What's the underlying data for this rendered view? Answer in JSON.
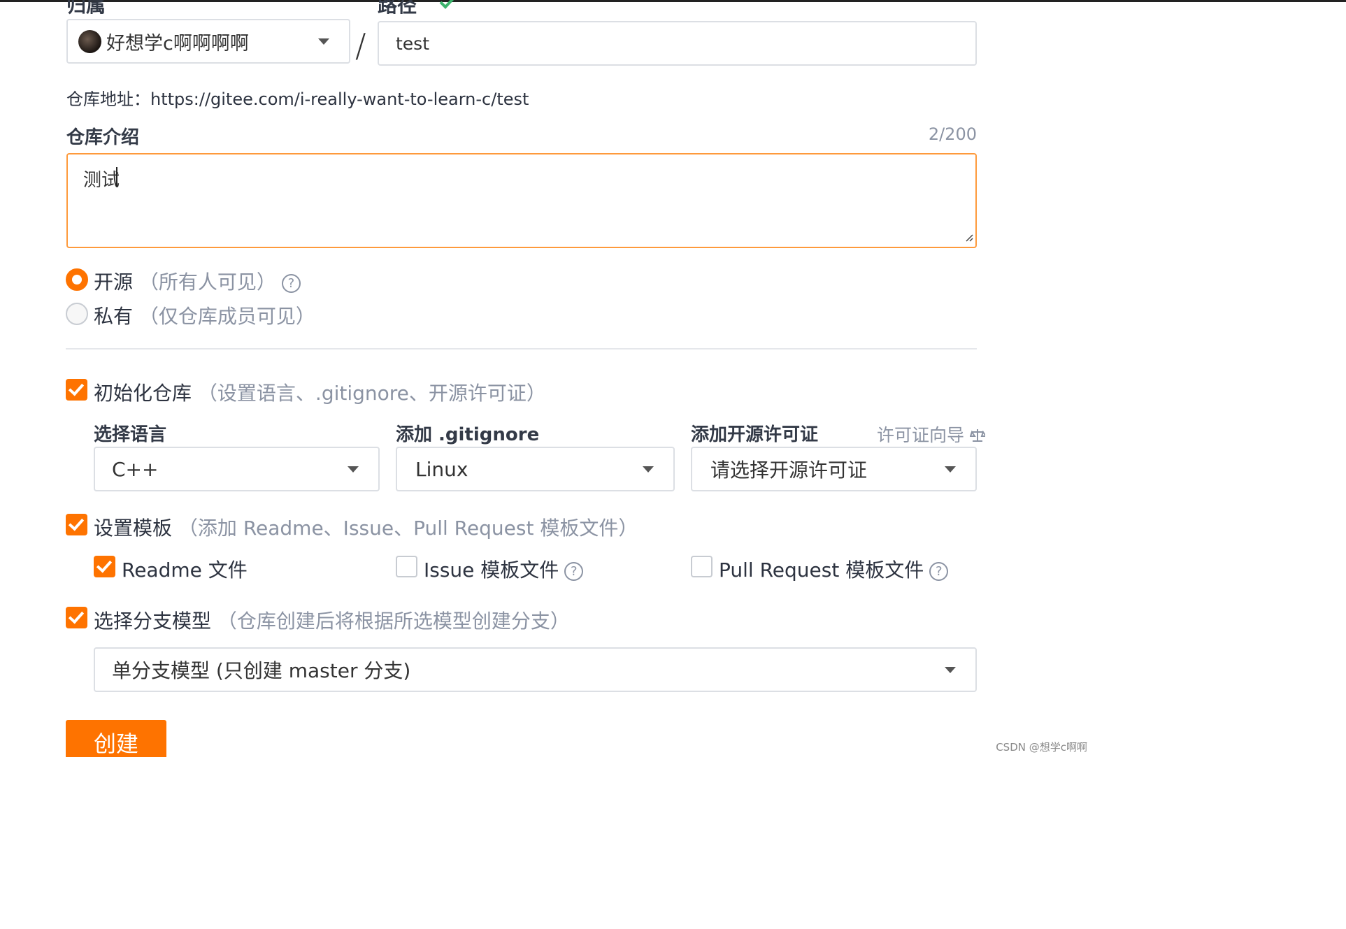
{
  "owner": {
    "label": "归属",
    "value": "好想学c啊啊啊啊"
  },
  "path": {
    "label": "路径",
    "required_mark": "*",
    "value": "test"
  },
  "separator": "/",
  "repo_address": {
    "label": "仓库地址：",
    "url": "https://gitee.com/i-really-want-to-learn-c/test"
  },
  "description": {
    "label": "仓库介绍",
    "counter": "2/200",
    "value": "测试"
  },
  "visibility": [
    {
      "label": "开源",
      "hint": "（所有人可见）",
      "selected": true
    },
    {
      "label": "私有",
      "hint": "（仅仓库成员可见）",
      "selected": false
    }
  ],
  "init_repo": {
    "label": "初始化仓库",
    "hint": "（设置语言、.gitignore、开源许可证）",
    "checked": true
  },
  "language": {
    "label": "选择语言",
    "value": "C++"
  },
  "gitignore": {
    "label": "添加 .gitignore",
    "value": "Linux"
  },
  "license": {
    "label": "添加开源许可证",
    "wizard_link": "许可证向导",
    "value": "请选择开源许可证"
  },
  "templates": {
    "label": "设置模板",
    "hint": "（添加 Readme、Issue、Pull Request 模板文件）",
    "checked": true,
    "readme": {
      "label": "Readme 文件",
      "checked": true
    },
    "issue": {
      "label": "Issue 模板文件",
      "checked": false
    },
    "pull_request": {
      "label": "Pull Request 模板文件",
      "checked": false
    }
  },
  "branch_model": {
    "label": "选择分支模型",
    "hint": "（仓库创建后将根据所选模型创建分支）",
    "checked": true,
    "value": "单分支模型 (只创建 master 分支)"
  },
  "create_button": "创建",
  "watermark": "CSDN @想学c啊啊",
  "colors": {
    "accent": "#fe7300",
    "success": "#3db46d",
    "required": "#e23d3d",
    "border": "#dcdfe4"
  },
  "icons": [
    "check-icon",
    "chevron-down-icon",
    "question-circle-icon",
    "scale-icon"
  ]
}
